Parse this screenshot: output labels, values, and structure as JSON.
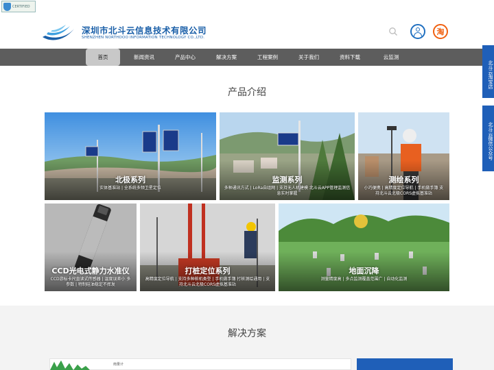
{
  "badge": {
    "text": "CERTIFIED"
  },
  "header": {
    "company_cn": "深圳市北斗云信息技术有限公司",
    "company_en": "SHENZHEN NORTHDOO INFORMATION TECHNOLOGY CO.,LTD."
  },
  "header_icons": {
    "taobao_glyph": "淘"
  },
  "nav": {
    "items": [
      {
        "label": "首页",
        "active": true
      },
      {
        "label": "新闻资讯"
      },
      {
        "label": "产品中心"
      },
      {
        "label": "解决方案"
      },
      {
        "label": "工程案例"
      },
      {
        "label": "关于我们"
      },
      {
        "label": "资料下载"
      },
      {
        "label": "云监测"
      }
    ]
  },
  "side_tabs": [
    {
      "label": "北斗云淘宝店"
    },
    {
      "label": "北斗云微信公众号"
    }
  ],
  "products": {
    "title": "产品介绍",
    "cards": [
      {
        "title": "北极系列",
        "desc": "实体基准站 | 全系统多频卫星定位"
      },
      {
        "title": "监测系列",
        "desc": "多种通讯方式 | LoRa自组网 | 支持无人机建模 北斗云APP管理监测信息实时掌握"
      },
      {
        "title": "测绘系列",
        "desc": "小巧便携 | 高精度定位导航 | 手机做手簿 支持北斗云北极CORS虚拟基准站"
      },
      {
        "title": "CCD光电式静力水准仪",
        "desc": "CCD游标卡尺直读式传感器 | 温度误差小 多参数 | 特制硅油稳定不挥发"
      },
      {
        "title": "打桩定位系列",
        "desc": "高精度定位导航 | 支持多种桩机类型 | 手机做手簿 打桩测绘通用 | 支持北斗云北极CORS虚拟基准站"
      },
      {
        "title": "地面沉降",
        "desc": "测量精度高 | 多点监测覆盖范围广 | 自动化监测"
      }
    ]
  },
  "solutions": {
    "title": "解决方案",
    "panel_label": "雨量计"
  },
  "colors": {
    "brand_blue": "#1a5fa8",
    "nav_bg": "#5d5d5d",
    "side_tab": "#1f5fb8",
    "taobao_orange": "#f06010"
  }
}
